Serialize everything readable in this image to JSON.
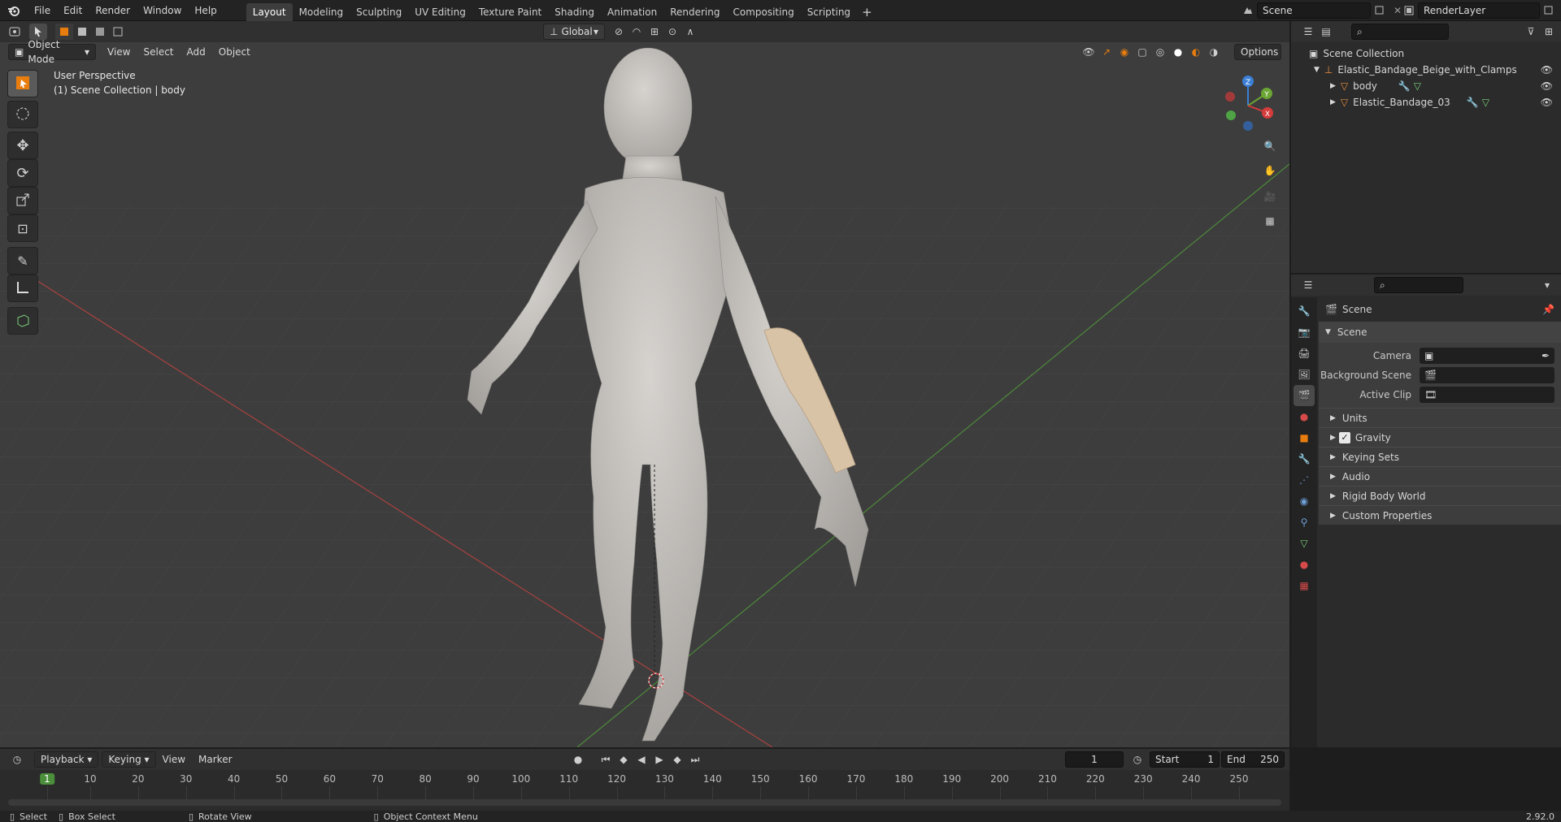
{
  "topbar": {
    "menus": [
      "File",
      "Edit",
      "Render",
      "Window",
      "Help"
    ],
    "workspaces": [
      "Layout",
      "Modeling",
      "Sculpting",
      "UV Editing",
      "Texture Paint",
      "Shading",
      "Animation",
      "Rendering",
      "Compositing",
      "Scripting"
    ],
    "active_workspace": "Layout",
    "scene_name": "Scene",
    "view_layer": "RenderLayer"
  },
  "viewport_header": {
    "mode": "Object Mode",
    "menus": [
      "View",
      "Select",
      "Add",
      "Object"
    ],
    "transform_orientation": "Global",
    "options_label": "Options"
  },
  "viewport": {
    "perspective_label": "User Perspective",
    "collection_label": "(1) Scene Collection | body",
    "gizmo_axes": [
      "X",
      "Y",
      "Z"
    ]
  },
  "outliner": {
    "root": "Scene Collection",
    "items": [
      {
        "name": "Elastic_Bandage_Beige_with_Clamps_Wrapp",
        "level": 1
      },
      {
        "name": "body",
        "level": 2
      },
      {
        "name": "Elastic_Bandage_03",
        "level": 2
      }
    ]
  },
  "properties": {
    "context": "Scene",
    "panel_title": "Scene",
    "fields": [
      {
        "label": "Camera",
        "value": ""
      },
      {
        "label": "Background Scene",
        "value": ""
      },
      {
        "label": "Active Clip",
        "value": ""
      }
    ],
    "subpanels": [
      "Units",
      "Gravity",
      "Keying Sets",
      "Audio",
      "Rigid Body World",
      "Custom Properties"
    ],
    "gravity_checked": true
  },
  "timeline": {
    "menus": [
      "Playback",
      "Keying",
      "View",
      "Marker"
    ],
    "current_frame": "1",
    "start_label": "Start",
    "start": "1",
    "end_label": "End",
    "end": "250",
    "ticks": [
      "1",
      "10",
      "20",
      "30",
      "40",
      "50",
      "60",
      "70",
      "80",
      "90",
      "100",
      "110",
      "120",
      "130",
      "140",
      "150",
      "160",
      "170",
      "180",
      "190",
      "200",
      "210",
      "220",
      "230",
      "240",
      "250"
    ]
  },
  "statusbar": {
    "select": "Select",
    "box_select": "Box Select",
    "rotate_view": "Rotate View",
    "context_menu": "Object Context Menu",
    "version": "2.92.0"
  },
  "colors": {
    "accent": "#e87d0d",
    "active_tab": "#3d3d3d",
    "axis_x": "#d63b3b",
    "axis_y": "#6ba534",
    "axis_z": "#3b7fd6"
  }
}
